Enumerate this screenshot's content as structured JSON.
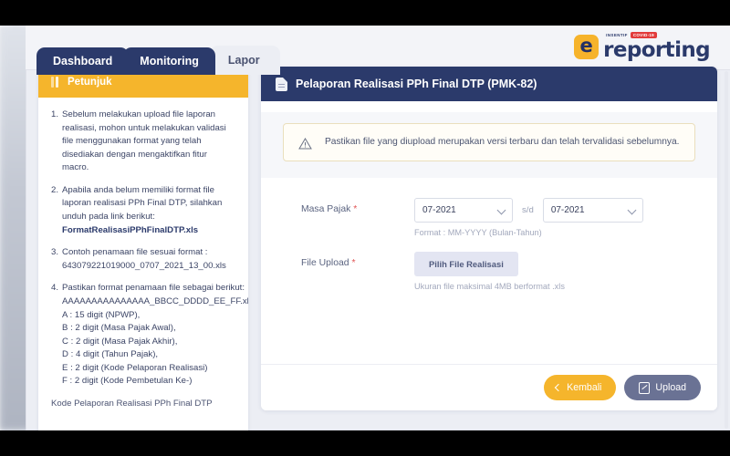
{
  "brand": {
    "mark_letter": "e",
    "tag_insentif": "INSENTIF",
    "tag_covid": "COVID-19",
    "word": "reporting",
    "accent_yellow": "#f5b52c",
    "accent_navy": "#2b3a6b"
  },
  "tabs": [
    {
      "label": "Dashboard",
      "state": "navy"
    },
    {
      "label": "Monitoring",
      "state": "navy"
    },
    {
      "label": "Lapor",
      "state": "current"
    }
  ],
  "instructions": {
    "header": "Petunjuk",
    "items": [
      {
        "num": "1.",
        "text": "Sebelum melakukan upload file laporan realisasi, mohon untuk melakukan validasi file menggunakan format yang telah disediakan dengan mengaktifkan fitur macro."
      },
      {
        "num": "2.",
        "text": "Apabila anda belum memiliki format file laporan realisasi PPh Final DTP, silahkan unduh pada link berikut:",
        "link": "FormatRealisasiPPhFinalDTP.xls"
      },
      {
        "num": "3.",
        "text": "Contoh penamaan file sesuai format :",
        "sub": [
          "643079221019000_0707_2021_13_00.xls"
        ]
      },
      {
        "num": "4.",
        "text": "Pastikan format penamaan file sebagai berikut:",
        "sub": [
          "AAAAAAAAAAAAAAA_BBCC_DDDD_EE_FF.xls",
          "A : 15 digit (NPWP),",
          "B : 2 digit (Masa Pajak Awal),",
          "C : 2 digit (Masa Pajak Akhir),",
          "D : 4 digit (Tahun Pajak),",
          "E : 2 digit (Kode Pelaporan Realisasi)",
          "F : 2 digit (Kode Pembetulan Ke-)"
        ]
      }
    ],
    "tail": "Kode Pelaporan Realisasi PPh Final DTP"
  },
  "panel": {
    "title": "Pelaporan Realisasi PPh Final DTP (PMK-82)",
    "alert": "Pastikan file yang diupload merupakan versi terbaru dan telah tervalidasi sebelumnya.",
    "form": {
      "masa_pajak": {
        "label": "Masa Pajak",
        "required_mark": "*",
        "from_value": "07-2021",
        "separator": "s/d",
        "to_value": "07-2021",
        "hint": "Format : MM-YYYY (Bulan-Tahun)"
      },
      "file_upload": {
        "label": "File Upload",
        "required_mark": "*",
        "button_label": "Pilih File Realisasi",
        "hint": "Ukuran file maksimal 4MB berformat .xls"
      }
    },
    "footer": {
      "back_label": "Kembali",
      "upload_label": "Upload"
    }
  }
}
